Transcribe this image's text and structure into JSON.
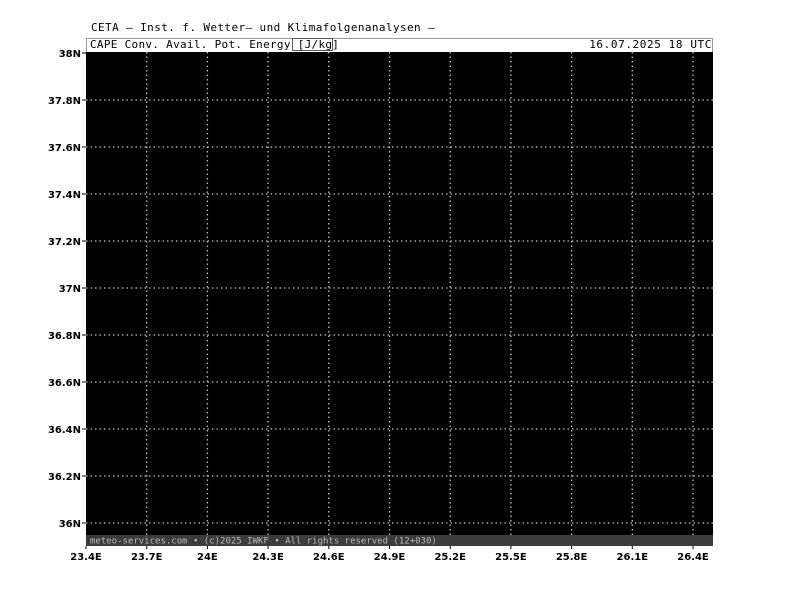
{
  "header": {
    "institute": "CETA — Inst. f. Wetter— und Klimafolgenanalysen —",
    "parameter_prefix": "CAPE Conv. Avail. Pot. Energy ",
    "parameter_unit": "[J/kg]",
    "datetime": "16.07.2025 18 UTC"
  },
  "map": {
    "lat_labels": [
      "38N",
      "37.8N",
      "37.6N",
      "37.4N",
      "37.2N",
      "37N",
      "36.8N",
      "36.6N",
      "36.4N",
      "36.2N",
      "36N"
    ],
    "lon_labels": [
      "23.4E",
      "23.7E",
      "24E",
      "24.3E",
      "24.6E",
      "24.9E",
      "25.2E",
      "25.5E",
      "25.8E",
      "26.1E",
      "26.4E"
    ],
    "background_color": "#000000",
    "grid_color": "#bfbfbf",
    "copyright": "meteo-services.com • (c)2025 IWKF • All rights reserved (12+030)"
  }
}
